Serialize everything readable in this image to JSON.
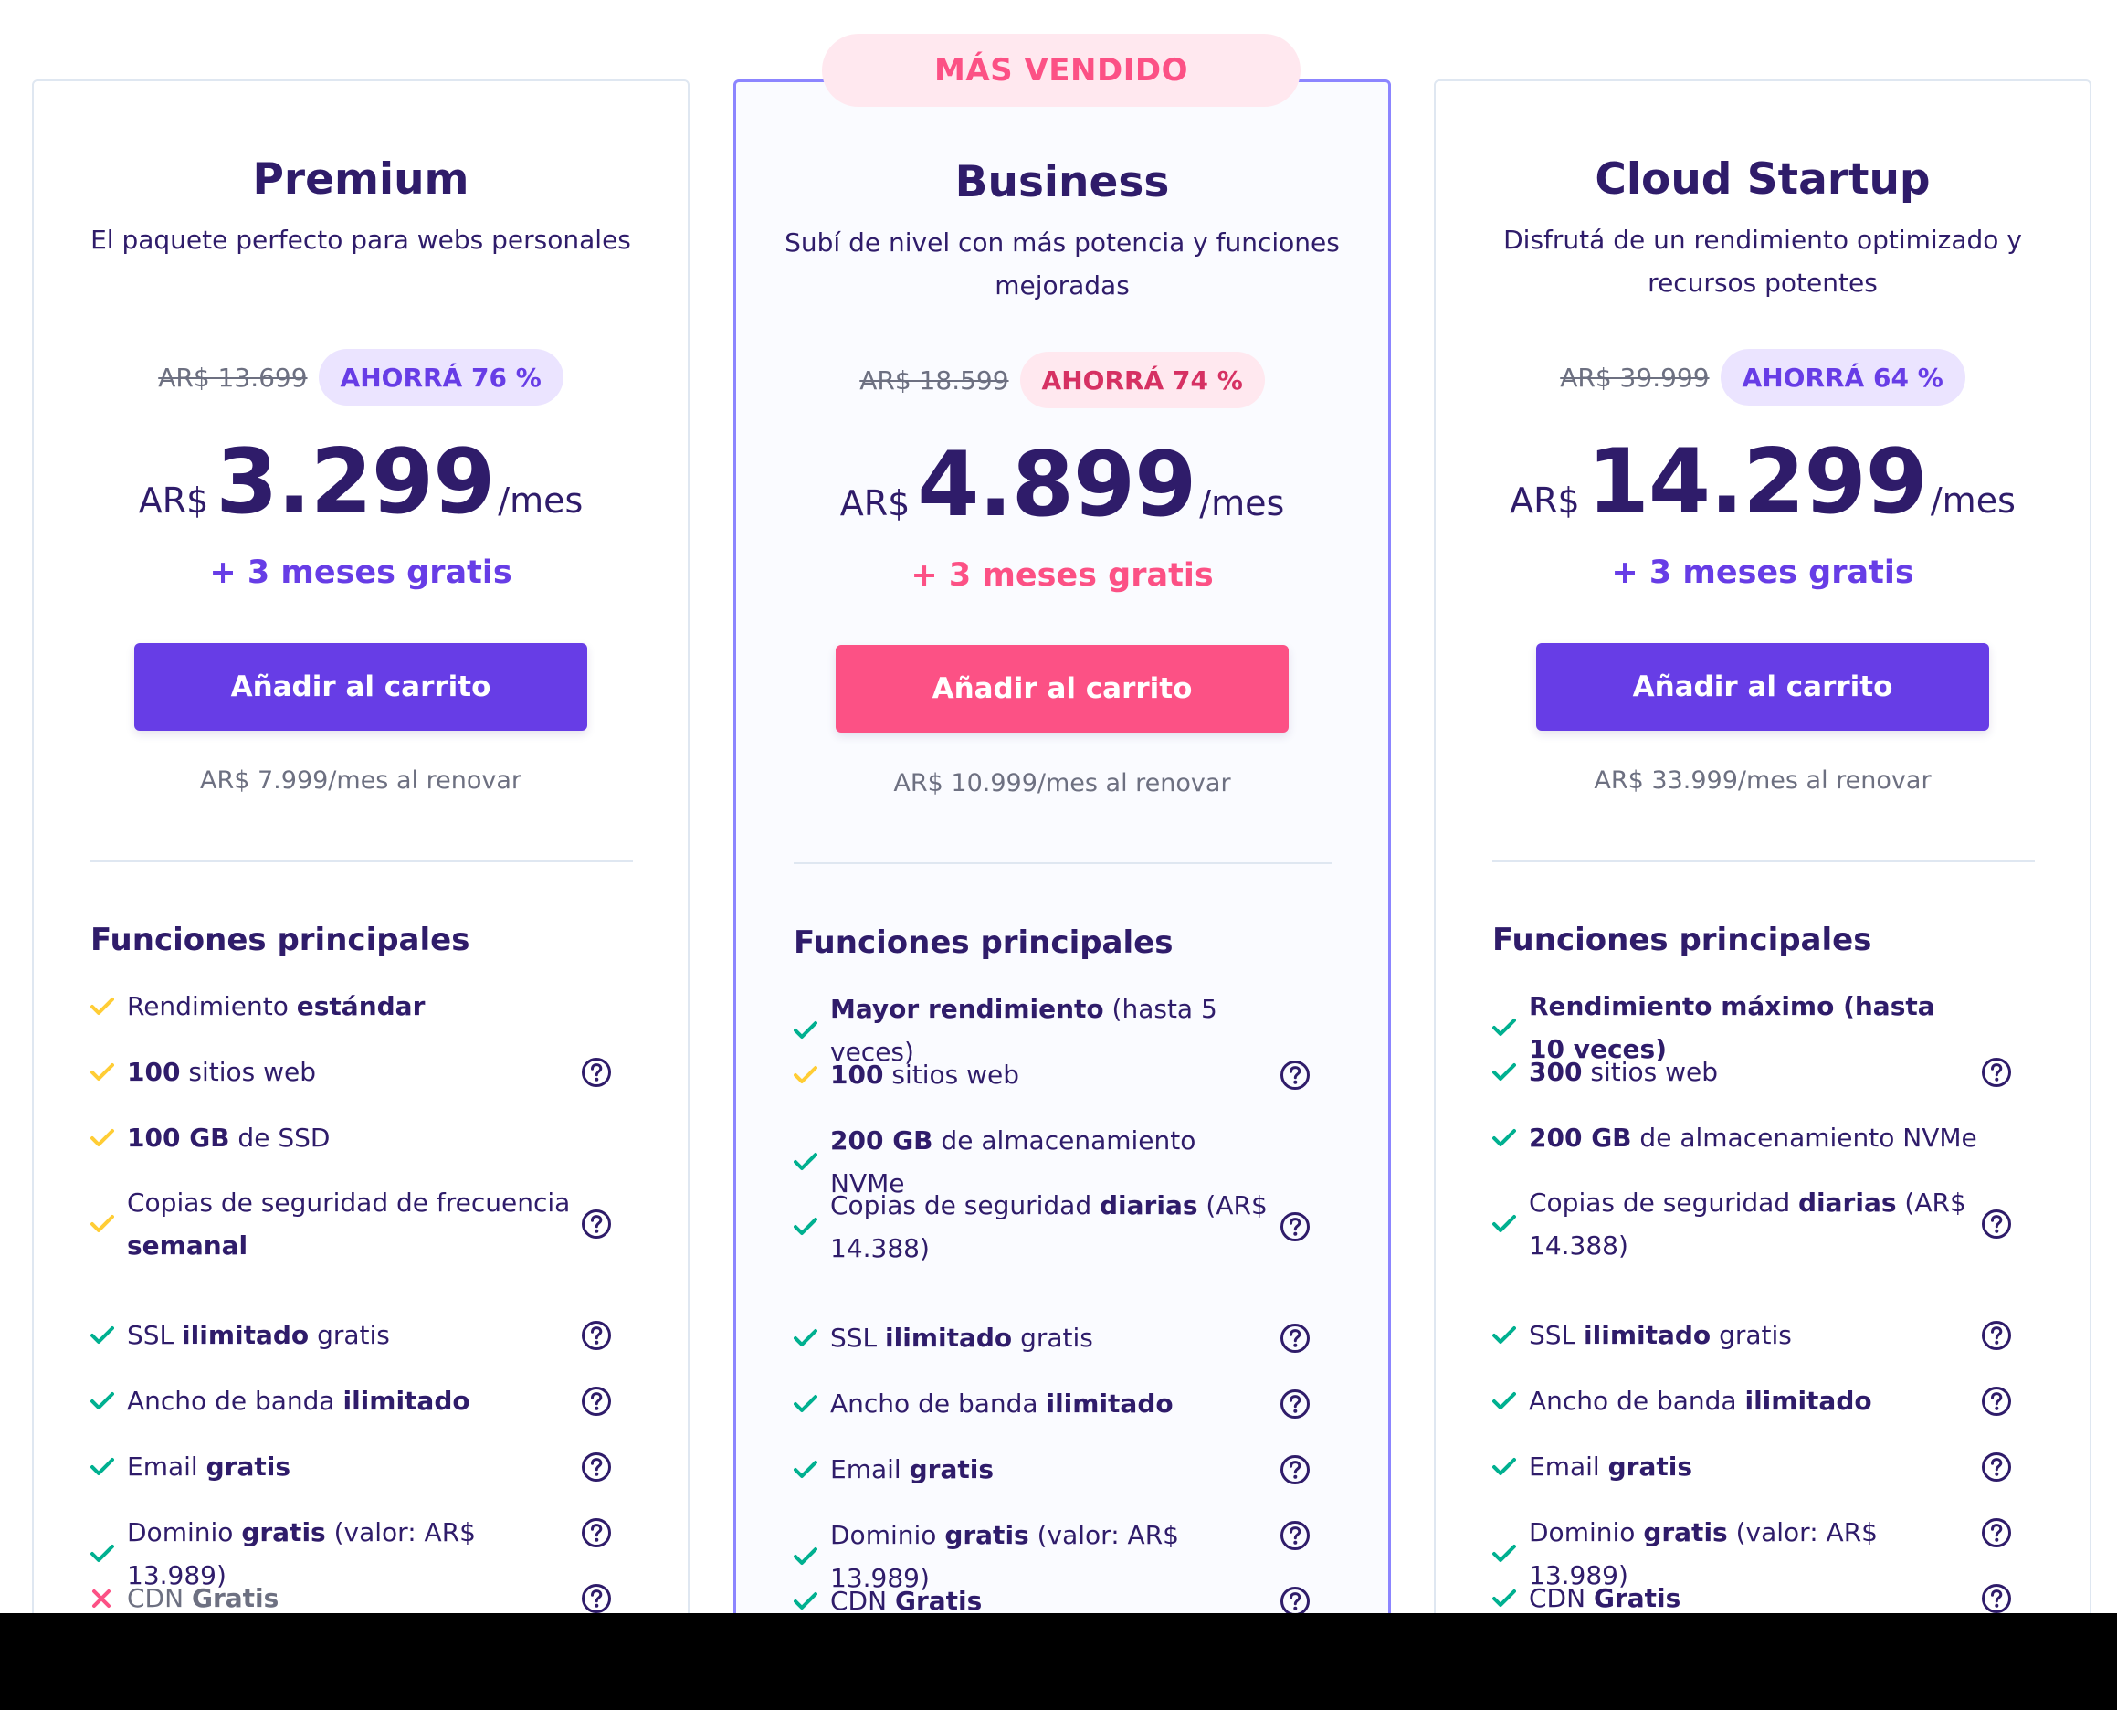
{
  "badge": "MÁS VENDIDO",
  "colors": {
    "primary": "#673de6",
    "accent_pink": "#fc5185",
    "dark_text": "#2f1c6a",
    "muted_text": "#6d7081",
    "check_green": "#00b090",
    "check_yellow": "#ffcd35",
    "cross_red": "#fc5185",
    "border": "#dfe7f1",
    "featured_border": "#8c85ff"
  },
  "plans": [
    {
      "name": "Premium",
      "subtitle_line1": "El paquete perfecto para webs personales",
      "subtitle_line2": "",
      "old_price": "AR$ 13.699",
      "save_label": "AHORRÁ 76 %",
      "currency": "AR$",
      "price": "3.299",
      "period": "/mes",
      "bonus": "+ 3 meses gratis",
      "cta": "Añadir al carrito",
      "renew": "AR$ 7.999/mes al renovar",
      "features_title": "Funciones principales",
      "features": [
        {
          "pre": "Rendimiento ",
          "bold": "estándar",
          "post": "",
          "icon": "check-yellow-icon",
          "help": false
        },
        {
          "pre": "",
          "bold": "100",
          "post": " sitios web",
          "icon": "check-yellow-icon",
          "help": true
        },
        {
          "pre": "",
          "bold": "100 GB",
          "post": " de SSD",
          "icon": "check-yellow-icon",
          "help": false
        },
        {
          "pre": "Copias de seguridad de frecuencia",
          "bold": "semanal",
          "post": "",
          "icon": "check-yellow-icon",
          "help": true
        },
        {
          "pre": "SSL ",
          "bold": "ilimitado",
          "post": " gratis",
          "icon": "check-green-icon",
          "help": true
        },
        {
          "pre": "Ancho de banda ",
          "bold": "ilimitado",
          "post": "",
          "icon": "check-green-icon",
          "help": true
        },
        {
          "pre": "Email ",
          "bold": "gratis",
          "post": "",
          "icon": "check-green-icon",
          "help": true
        },
        {
          "pre": "Dominio ",
          "bold": "gratis",
          "post": " (valor: AR$ 13.989)",
          "icon": "check-green-icon",
          "help": true
        },
        {
          "pre": "CDN ",
          "bold": "Gratis",
          "post": "",
          "icon": "cross-icon",
          "help": true
        }
      ]
    },
    {
      "name": "Business",
      "subtitle_line1": "Subí de nivel con más potencia y funciones",
      "subtitle_line2": "mejoradas",
      "old_price": "AR$ 18.599",
      "save_label": "AHORRÁ 74 %",
      "currency": "AR$",
      "price": "4.899",
      "period": "/mes",
      "bonus": "+ 3 meses gratis",
      "cta": "Añadir al carrito",
      "renew": "AR$ 10.999/mes al renovar",
      "features_title": "Funciones principales",
      "features": [
        {
          "pre": "",
          "bold": "Mayor rendimiento",
          "post": " (hasta 5 veces)",
          "icon": "check-green-icon",
          "help": false
        },
        {
          "pre": "",
          "bold": "100",
          "post": " sitios web",
          "icon": "check-yellow-icon",
          "help": true
        },
        {
          "pre": "",
          "bold": "200 GB",
          "post": " de almacenamiento NVMe",
          "icon": "check-green-icon",
          "help": false
        },
        {
          "pre": "Copias de seguridad ",
          "bold": "diarias",
          "post": " (AR$",
          "post2": "14.388)",
          "icon": "check-green-icon",
          "help": true
        },
        {
          "pre": "SSL ",
          "bold": "ilimitado",
          "post": " gratis",
          "icon": "check-green-icon",
          "help": true
        },
        {
          "pre": "Ancho de banda ",
          "bold": "ilimitado",
          "post": "",
          "icon": "check-green-icon",
          "help": true
        },
        {
          "pre": "Email ",
          "bold": "gratis",
          "post": "",
          "icon": "check-green-icon",
          "help": true
        },
        {
          "pre": "Dominio ",
          "bold": "gratis",
          "post": " (valor: AR$ 13.989)",
          "icon": "check-green-icon",
          "help": true
        },
        {
          "pre": "CDN ",
          "bold": "Gratis",
          "post": "",
          "icon": "check-green-icon",
          "help": true
        }
      ]
    },
    {
      "name": "Cloud Startup",
      "subtitle_line1": "Disfrutá de un rendimiento optimizado y",
      "subtitle_line2": "recursos potentes",
      "old_price": "AR$ 39.999",
      "save_label": "AHORRÁ 64 %",
      "currency": "AR$",
      "price": "14.299",
      "period": "/mes",
      "bonus": "+ 3 meses gratis",
      "cta": "Añadir al carrito",
      "renew": "AR$ 33.999/mes al renovar",
      "features_title": "Funciones principales",
      "features": [
        {
          "pre": "",
          "bold": "Rendimiento máximo (hasta 10 veces)",
          "post": "",
          "icon": "check-green-icon",
          "help": false
        },
        {
          "pre": "",
          "bold": "300",
          "post": " sitios web",
          "icon": "check-green-icon",
          "help": true
        },
        {
          "pre": "",
          "bold": "200 GB",
          "post": " de almacenamiento NVMe",
          "icon": "check-green-icon",
          "help": false
        },
        {
          "pre": "Copias de seguridad ",
          "bold": "diarias",
          "post": " (AR$",
          "post2": "14.388)",
          "icon": "check-green-icon",
          "help": true
        },
        {
          "pre": "SSL ",
          "bold": "ilimitado",
          "post": " gratis",
          "icon": "check-green-icon",
          "help": true
        },
        {
          "pre": "Ancho de banda ",
          "bold": "ilimitado",
          "post": "",
          "icon": "check-green-icon",
          "help": true
        },
        {
          "pre": "Email ",
          "bold": "gratis",
          "post": "",
          "icon": "check-green-icon",
          "help": true
        },
        {
          "pre": "Dominio ",
          "bold": "gratis",
          "post": " (valor: AR$ 13.989)",
          "icon": "check-green-icon",
          "help": true
        },
        {
          "pre": "CDN ",
          "bold": "Gratis",
          "post": "",
          "icon": "check-green-icon",
          "help": true
        }
      ]
    }
  ]
}
